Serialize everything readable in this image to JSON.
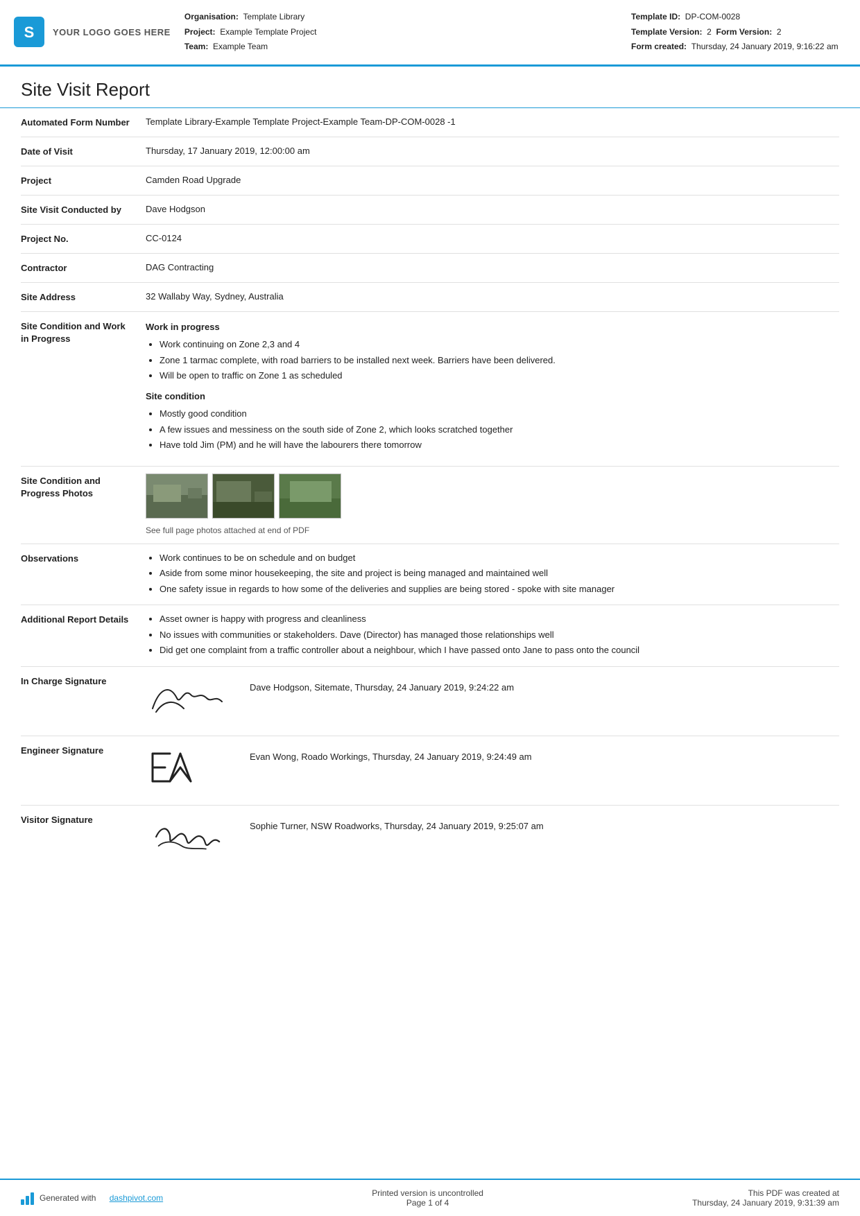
{
  "header": {
    "logo_text": "YOUR LOGO GOES HERE",
    "org_label": "Organisation:",
    "org_value": "Template Library",
    "project_label": "Project:",
    "project_value": "Example Template Project",
    "team_label": "Team:",
    "team_value": "Example Team",
    "template_id_label": "Template ID:",
    "template_id_value": "DP-COM-0028",
    "template_version_label": "Template Version:",
    "template_version_value": "2",
    "form_version_label": "Form Version:",
    "form_version_value": "2",
    "form_created_label": "Form created:",
    "form_created_value": "Thursday, 24 January 2019, 9:16:22 am"
  },
  "report": {
    "title": "Site Visit Report",
    "rows": [
      {
        "label": "Automated Form Number",
        "value": "Template Library-Example Template Project-Example Team-DP-COM-0028   -1"
      },
      {
        "label": "Date of Visit",
        "value": "Thursday, 17 January 2019, 12:00:00 am"
      },
      {
        "label": "Project",
        "value": "Camden Road Upgrade"
      },
      {
        "label": "Site Visit Conducted by",
        "value": "Dave Hodgson"
      },
      {
        "label": "Project No.",
        "value": "CC-0124"
      },
      {
        "label": "Contractor",
        "value": "DAG Contracting"
      },
      {
        "label": "Site Address",
        "value": "32 Wallaby Way, Sydney, Australia"
      }
    ],
    "site_condition_label": "Site Condition and Work in Progress",
    "site_condition_subsections": [
      {
        "subtitle": "Work in progress",
        "items": [
          "Work continuing on Zone 2,3 and 4",
          "Zone 1 tarmac complete, with road barriers to be installed next week. Barriers have been delivered.",
          "Will be open to traffic on Zone 1 as scheduled"
        ]
      },
      {
        "subtitle": "Site condition",
        "items": [
          "Mostly good condition",
          "A few issues and messiness on the south side of Zone 2, which looks scratched together",
          "Have told Jim (PM) and he will have the labourers there tomorrow"
        ]
      }
    ],
    "photos_label": "Site Condition and Progress Photos",
    "photos_caption": "See full page photos attached at end of PDF",
    "observations_label": "Observations",
    "observations_items": [
      "Work continues to be on schedule and on budget",
      "Aside from some minor housekeeping, the site and project is being managed and maintained well",
      "One safety issue in regards to how some of the deliveries and supplies are being stored - spoke with site manager"
    ],
    "additional_label": "Additional Report Details",
    "additional_items": [
      "Asset owner is happy with progress and cleanliness",
      "No issues with communities or stakeholders. Dave (Director) has managed those relationships well",
      "Did get one complaint from a traffic controller about a neighbour, which I have passed onto Jane to pass onto the council"
    ],
    "signatures": [
      {
        "label": "In Charge Signature",
        "sig_type": "cursive",
        "sig_text": "Dave Hodgson, Sitemate, Thursday, 24 January 2019, 9:24:22 am"
      },
      {
        "label": "Engineer Signature",
        "sig_type": "block",
        "sig_text": "Evan Wong, Roado Workings, Thursday, 24 January 2019, 9:24:49 am"
      },
      {
        "label": "Visitor Signature",
        "sig_type": "script",
        "sig_text": "Sophie Turner, NSW Roadworks, Thursday, 24 January 2019, 9:25:07 am"
      }
    ]
  },
  "footer": {
    "generated_text": "Generated with",
    "link_text": "dashpivot.com",
    "center_text": "Printed version is uncontrolled",
    "page_text": "Page 1 of 4",
    "right_text": "This PDF was created at",
    "right_date": "Thursday, 24 January 2019, 9:31:39 am"
  }
}
